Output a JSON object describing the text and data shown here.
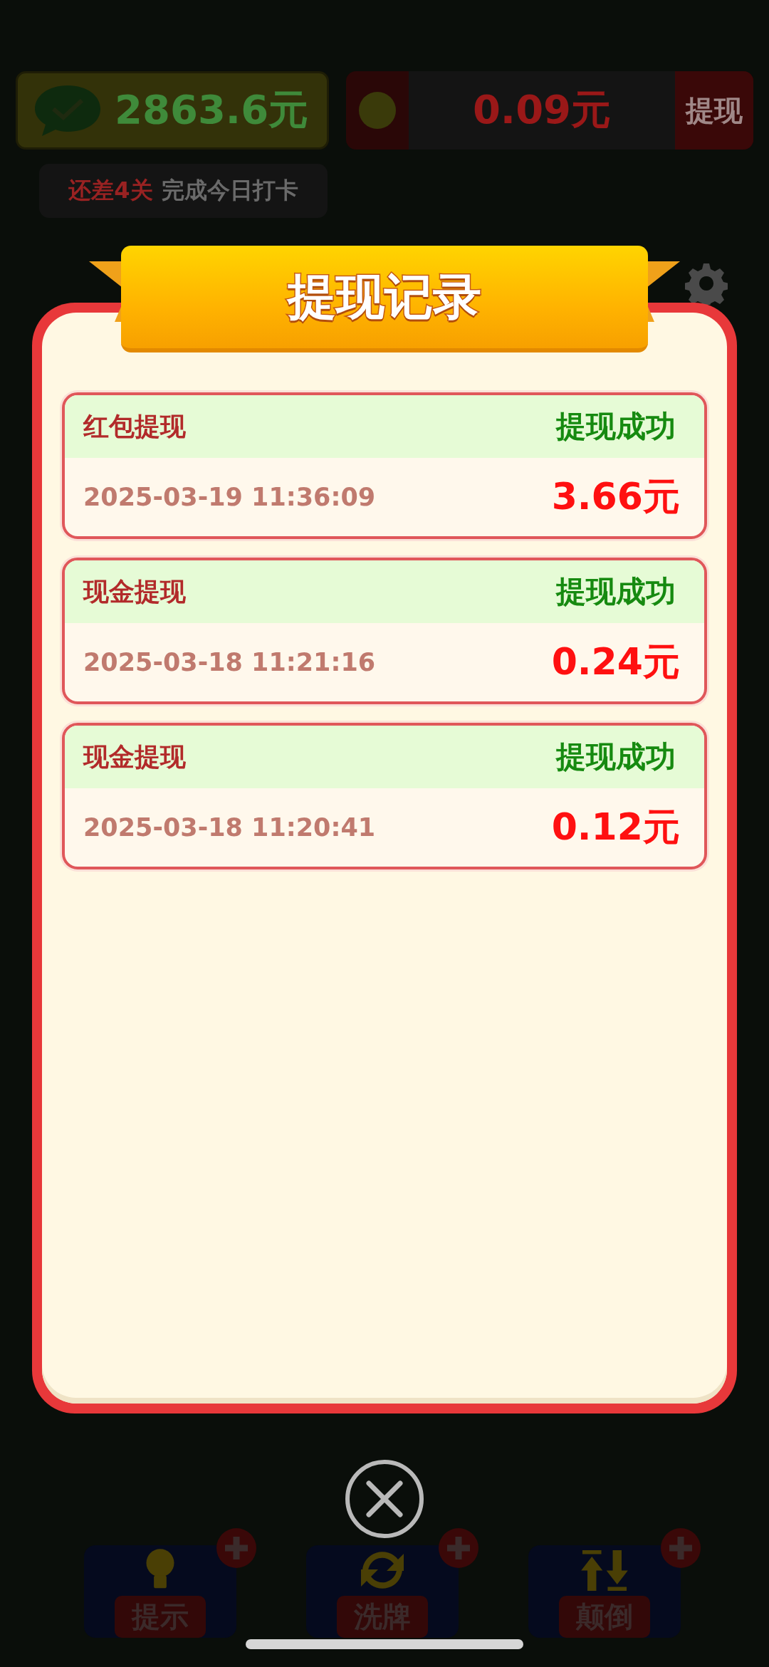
{
  "top_bar": {
    "balance": "2863.6元",
    "red_packet_balance": "0.09元",
    "withdraw_button": "提现"
  },
  "hint": {
    "levels_left": "还差4关",
    "goal": "完成今日打卡"
  },
  "modal": {
    "title": "提现记录",
    "records": [
      {
        "type": "红包提现",
        "status": "提现成功",
        "time": "2025-03-19 11:36:09",
        "amount": "3.66元"
      },
      {
        "type": "现金提现",
        "status": "提现成功",
        "time": "2025-03-18 11:21:16",
        "amount": "0.24元"
      },
      {
        "type": "现金提现",
        "status": "提现成功",
        "time": "2025-03-18 11:20:41",
        "amount": "0.12元"
      }
    ]
  },
  "tools": [
    {
      "label": "提示",
      "kind": "bulb"
    },
    {
      "label": "洗牌",
      "kind": "shuffle"
    },
    {
      "label": "颠倒",
      "kind": "flip"
    }
  ]
}
